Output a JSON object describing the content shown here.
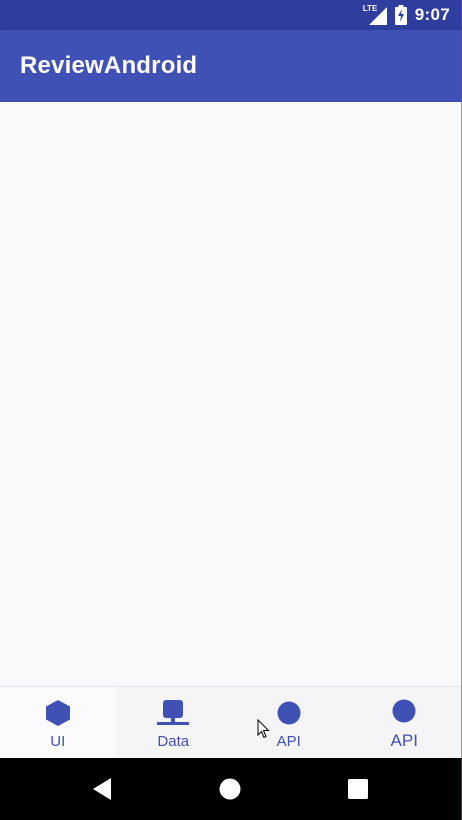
{
  "status_bar": {
    "network_type": "LTE",
    "time": "9:07",
    "icons": [
      "lte-icon",
      "signal-icon",
      "battery-charging-icon"
    ]
  },
  "app_bar": {
    "title": "ReviewAndroid"
  },
  "bottom_nav": {
    "items": [
      {
        "label": "UI",
        "icon": "hexagon-icon",
        "selected": true
      },
      {
        "label": "Data",
        "icon": "computer-icon",
        "selected": false
      },
      {
        "label": "API",
        "icon": "circle-icon",
        "selected": false
      },
      {
        "label": "API",
        "icon": "circle-icon",
        "selected": false
      }
    ]
  },
  "system_nav": {
    "buttons": [
      "back-icon",
      "home-icon",
      "recents-icon"
    ]
  },
  "colors": {
    "primary": "#3f51b5",
    "primary_dark": "#2f3e9e",
    "background": "#f9f9fb",
    "nav_bar": "#000000"
  }
}
